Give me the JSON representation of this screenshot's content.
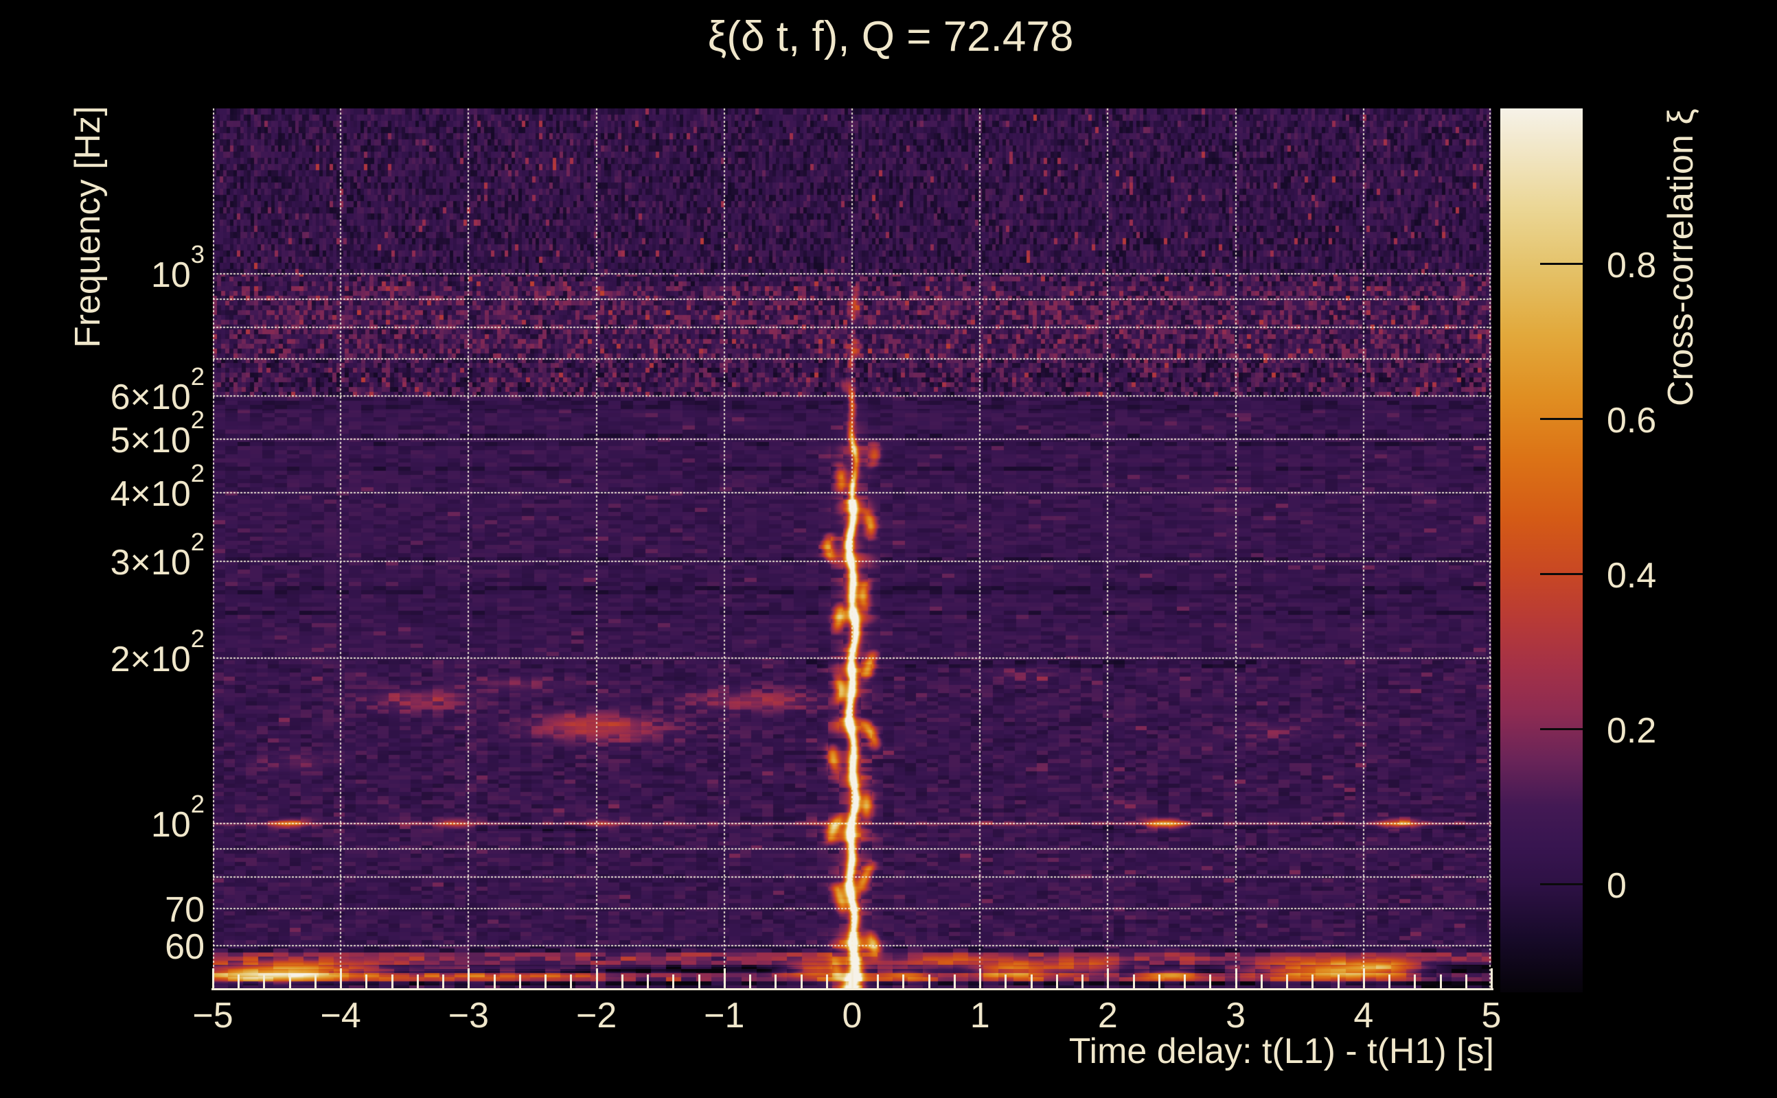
{
  "page": {
    "background": "#000000",
    "text_color": "#f0e7cb",
    "accent_grid_color": "#f3ecd8"
  },
  "chart_data": {
    "type": "heatmap",
    "title": "ξ(δ t, f), Q = 72.478",
    "q_value": 72.478,
    "xlabel": "Time delay: t(L1) - t(H1) [s]",
    "ylabel": "Frequency [Hz]",
    "colorbar_label": "Cross-correlation ξ",
    "x_range": [
      -5,
      5
    ],
    "x_minor_tick_step": 0.2,
    "x_gridlines": [
      -5,
      -4,
      -3,
      -2,
      -1,
      0,
      1,
      2,
      3,
      4,
      5
    ],
    "x_tick_labels": [
      {
        "value": -5,
        "text": "−5"
      },
      {
        "value": -4,
        "text": "−4"
      },
      {
        "value": -3,
        "text": "−3"
      },
      {
        "value": -2,
        "text": "−2"
      },
      {
        "value": -1,
        "text": "−1"
      },
      {
        "value": 0,
        "text": "0"
      },
      {
        "value": 1,
        "text": "1"
      },
      {
        "value": 2,
        "text": "2"
      },
      {
        "value": 3,
        "text": "3"
      },
      {
        "value": 4,
        "text": "4"
      },
      {
        "value": 5,
        "text": "5"
      }
    ],
    "y_scale": "log",
    "y_range_hz": [
      50,
      2000
    ],
    "y_gridlines_hz": [
      60,
      70,
      80,
      90,
      100,
      200,
      300,
      400,
      500,
      600,
      700,
      800,
      900,
      1000
    ],
    "y_tick_labels": [
      {
        "value": 1000,
        "mantissa": "10",
        "exp": "3"
      },
      {
        "value": 600,
        "mantissa": "6×10",
        "exp": "2"
      },
      {
        "value": 500,
        "mantissa": "5×10",
        "exp": "2"
      },
      {
        "value": 400,
        "mantissa": "4×10",
        "exp": "2"
      },
      {
        "value": 300,
        "mantissa": "3×10",
        "exp": "2"
      },
      {
        "value": 200,
        "mantissa": "2×10",
        "exp": "2"
      },
      {
        "value": 100,
        "mantissa": "10",
        "exp": "2"
      },
      {
        "value": 70,
        "mantissa": "70",
        "exp": ""
      },
      {
        "value": 60,
        "mantissa": "60",
        "exp": ""
      }
    ],
    "colorbar": {
      "range": [
        -0.14,
        1.0
      ],
      "ticks": [
        {
          "value": 0.8,
          "text": "0.8"
        },
        {
          "value": 0.6,
          "text": "0.6"
        },
        {
          "value": 0.4,
          "text": "0.4"
        },
        {
          "value": 0.2,
          "text": "0.2"
        },
        {
          "value": 0.0,
          "text": "0"
        }
      ],
      "stops": [
        [
          -0.14,
          "#060309"
        ],
        [
          -0.07,
          "#170a29"
        ],
        [
          0.0,
          "#2e1145"
        ],
        [
          0.05,
          "#381550"
        ],
        [
          0.1,
          "#431954"
        ],
        [
          0.16,
          "#6a2458"
        ],
        [
          0.22,
          "#8d2b52"
        ],
        [
          0.28,
          "#a43147"
        ],
        [
          0.34,
          "#b83a36"
        ],
        [
          0.4,
          "#c84724"
        ],
        [
          0.47,
          "#d45a16"
        ],
        [
          0.55,
          "#dc7316"
        ],
        [
          0.63,
          "#e08f22"
        ],
        [
          0.71,
          "#e2a93c"
        ],
        [
          0.79,
          "#e4c167"
        ],
        [
          0.87,
          "#ebd694"
        ],
        [
          0.94,
          "#f1e5c2"
        ],
        [
          1.0,
          "#f6f2e8"
        ]
      ]
    },
    "texture_zones": [
      {
        "f_lo": 1000,
        "f_hi": 2000,
        "base": 0.025,
        "amp": 0.2,
        "cell": [
          5,
          9
        ],
        "fleck_p": 0.035,
        "fleck_amp": 0.16
      },
      {
        "f_lo": 600,
        "f_hi": 1000,
        "base": 0.05,
        "amp": 0.26,
        "cell": [
          6,
          7
        ],
        "fleck_p": 0.06,
        "fleck_amp": 0.13
      },
      {
        "f_lo": 200,
        "f_hi": 600,
        "base": 0.048,
        "amp": 0.12,
        "cell": [
          18,
          6
        ],
        "fleck_p": 0.08,
        "fleck_amp": 0.05
      },
      {
        "f_lo": 100,
        "f_hi": 200,
        "base": 0.05,
        "amp": 0.15,
        "cell": [
          16,
          6
        ],
        "fleck_p": 0.05,
        "fleck_amp": 0.06
      },
      {
        "f_lo": 60,
        "f_hi": 100,
        "base": 0.05,
        "amp": 0.14,
        "cell": [
          16,
          6
        ],
        "fleck_p": 0.04,
        "fleck_amp": 0.06
      },
      {
        "f_lo": 50,
        "f_hi": 60,
        "base": 0.03,
        "amp": 0.2,
        "cell": [
          22,
          6
        ],
        "fleck_p": 0.0,
        "fleck_amp": 0.0
      }
    ],
    "features": {
      "ridge": {
        "t": 0.0,
        "f_min_hz": 55,
        "f_max_hz": 950,
        "peak_xi": 1.0,
        "note": "braided bright cross-correlation ridge at zero time delay, saturating to white below ~300 Hz and flaring at the bottom"
      },
      "line_100hz": {
        "f_hz": 100,
        "boost": 0.18,
        "blobs": [
          {
            "t": -4.4,
            "amp": 0.3
          },
          {
            "t": -3.1,
            "amp": 0.2
          },
          {
            "t": -2.0,
            "amp": 0.16
          },
          {
            "t": -0.15,
            "amp": 0.18
          },
          {
            "t": 2.44,
            "amp": 0.55
          },
          {
            "t": 4.28,
            "amp": 0.42
          }
        ]
      },
      "mid_clouds": [
        {
          "t": -3.39,
          "f_hz": 167,
          "sx": 55,
          "sy": 12,
          "amp": 0.18
        },
        {
          "t": -1.99,
          "f_hz": 150,
          "sx": 70,
          "sy": 14,
          "amp": 0.28
        },
        {
          "t": -0.76,
          "f_hz": 168,
          "sx": 70,
          "sy": 12,
          "amp": 0.2
        },
        {
          "t": -2.69,
          "f_hz": 180,
          "sx": 50,
          "sy": 8,
          "amp": 0.12
        },
        {
          "t": 1.34,
          "f_hz": 187,
          "sx": 40,
          "sy": 8,
          "amp": 0.1
        },
        {
          "t": 3.27,
          "f_hz": 147,
          "sx": 50,
          "sy": 10,
          "amp": 0.1
        },
        {
          "t": -4.36,
          "f_hz": 130,
          "sx": 40,
          "sy": 10,
          "amp": 0.1
        }
      ],
      "bottom_blobs": [
        {
          "t": -4.36,
          "f_hz": 54,
          "sx": 90,
          "sy": 9,
          "amp": 0.55
        },
        {
          "t": -4.68,
          "f_hz": 53,
          "sx": 70,
          "sy": 7,
          "amp": 0.4
        },
        {
          "t": -2.74,
          "f_hz": 53,
          "sx": 110,
          "sy": 7,
          "amp": 0.28
        },
        {
          "t": -0.3,
          "f_hz": 54,
          "sx": 30,
          "sy": 8,
          "amp": 0.45
        },
        {
          "t": 0.42,
          "f_hz": 53,
          "sx": 26,
          "sy": 7,
          "amp": 0.38
        },
        {
          "t": 0.75,
          "f_hz": 56,
          "sx": 60,
          "sy": 7,
          "amp": 0.22
        },
        {
          "t": 1.28,
          "f_hz": 54,
          "sx": 42,
          "sy": 9,
          "amp": 0.5
        },
        {
          "t": 1.82,
          "f_hz": 55,
          "sx": 40,
          "sy": 8,
          "amp": 0.33
        },
        {
          "t": 2.49,
          "f_hz": 53,
          "sx": 30,
          "sy": 6,
          "amp": 0.45
        },
        {
          "t": 3.7,
          "f_hz": 54,
          "sx": 75,
          "sy": 9,
          "amp": 0.6
        },
        {
          "t": 4.13,
          "f_hz": 55,
          "sx": 40,
          "sy": 8,
          "amp": 0.4
        }
      ],
      "dark_patches": [
        {
          "t0": -4.09,
          "t1": -1.99,
          "f0": 52.9,
          "f1": 53.9,
          "amp": -0.1
        },
        {
          "t0": -1.99,
          "t1": -0.38,
          "f0": 53.8,
          "f1": 54.8,
          "amp": -0.08
        },
        {
          "t0": 2.68,
          "t1": 3.4,
          "f0": 52.6,
          "f1": 53.6,
          "amp": -0.09
        },
        {
          "t0": 4.45,
          "t1": 5.0,
          "f0": 50.0,
          "f1": 56.0,
          "amp": -0.1
        },
        {
          "t0": -5.0,
          "t1": 5.0,
          "f0": 55.2,
          "f1": 56.3,
          "amp": -0.05
        },
        {
          "t0": -2.95,
          "t1": -1.99,
          "f0": 97.0,
          "f1": 99.5,
          "amp": -0.07
        },
        {
          "t0": 1.66,
          "t1": 5.0,
          "f0": 97.5,
          "f1": 99.5,
          "amp": -0.05
        },
        {
          "t0": -5.0,
          "t1": 5.0,
          "f0": 565,
          "f1": 595,
          "amp": -0.035
        },
        {
          "t0": -0.5,
          "t1": 3.2,
          "f0": 192,
          "f1": 199,
          "amp": -0.05
        }
      ]
    }
  }
}
